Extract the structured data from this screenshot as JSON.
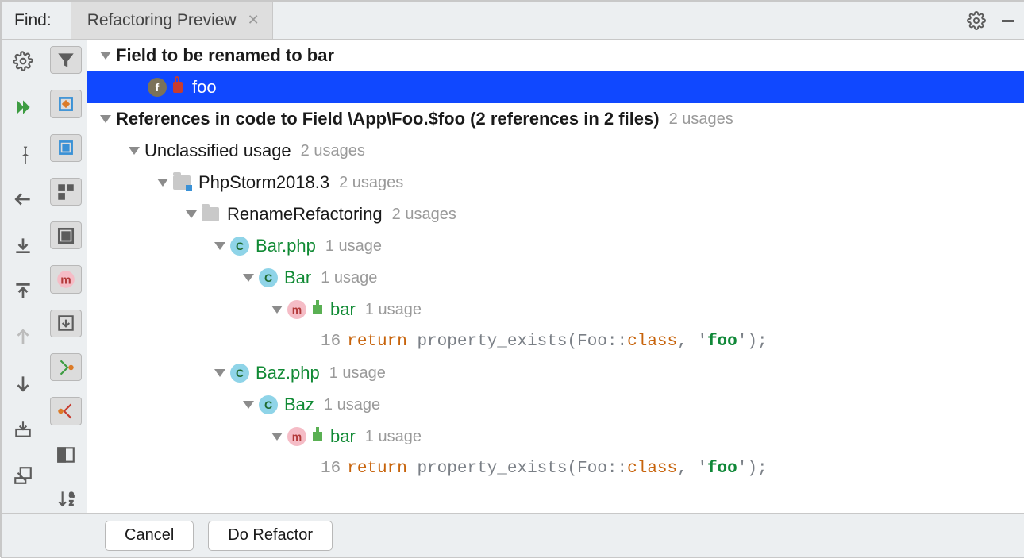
{
  "header": {
    "find_label": "Find:",
    "tab_title": "Refactoring Preview"
  },
  "sidebar_left": [
    {
      "name": "settings",
      "kind": "gear",
      "active": false
    },
    {
      "name": "rerun",
      "kind": "play2",
      "active": false
    },
    {
      "name": "pin",
      "kind": "pin",
      "active": false
    },
    {
      "name": "back",
      "kind": "arrow-left",
      "active": false
    },
    {
      "name": "expand-all",
      "kind": "expand",
      "active": false
    },
    {
      "name": "collapse-all",
      "kind": "collapse",
      "active": false
    },
    {
      "name": "prev",
      "kind": "arrow-up",
      "active": false
    },
    {
      "name": "next",
      "kind": "arrow-down",
      "active": false
    },
    {
      "name": "export",
      "kind": "export",
      "active": false
    },
    {
      "name": "open-new",
      "kind": "open-new",
      "active": false
    }
  ],
  "sidebar_right": [
    {
      "name": "filter",
      "kind": "funnel",
      "active": true
    },
    {
      "name": "group-module",
      "kind": "module",
      "active": true
    },
    {
      "name": "group-file",
      "kind": "file",
      "active": true
    },
    {
      "name": "group-package",
      "kind": "package",
      "active": true
    },
    {
      "name": "group-method",
      "kind": "method",
      "active": true
    },
    {
      "name": "preview-import",
      "kind": "import",
      "active": true
    },
    {
      "name": "show-read",
      "kind": "read",
      "active": true
    },
    {
      "name": "show-write",
      "kind": "write",
      "active": true
    },
    {
      "name": "preview-panel",
      "kind": "panel",
      "active": false
    },
    {
      "name": "sort",
      "kind": "sort",
      "active": false
    }
  ],
  "tree": {
    "field_heading": "Field to be renamed to bar",
    "field_name": "foo",
    "refs_heading": "References in code to Field \\App\\Foo.$foo (2 references in 2 files)",
    "refs_heading_usages": "2 usages",
    "unclassified_label": "Unclassified usage",
    "unclassified_usages": "2 usages",
    "project_name": "PhpStorm2018.3",
    "project_usages": "2 usages",
    "folder_name": "RenameRefactoring",
    "folder_usages": "2 usages",
    "files": [
      {
        "file": "Bar.php",
        "file_usages": "1 usage",
        "class": "Bar",
        "class_usages": "1 usage",
        "method": "bar",
        "method_usages": "1 usage",
        "line_no": "16",
        "code": {
          "kw": "return",
          "sp": " ",
          "fn": "property_exists",
          "open": "(",
          "ns": "Foo::",
          "cls": "class",
          "comma": ", ",
          "q1": "'",
          "str": "foo",
          "q2": "'",
          "close": ");"
        }
      },
      {
        "file": "Baz.php",
        "file_usages": "1 usage",
        "class": "Baz",
        "class_usages": "1 usage",
        "method": "bar",
        "method_usages": "1 usage",
        "line_no": "16",
        "code": {
          "kw": "return",
          "sp": " ",
          "fn": "property_exists",
          "open": "(",
          "ns": "Foo::",
          "cls": "class",
          "comma": ", ",
          "q1": "'",
          "str": "foo",
          "q2": "'",
          "close": ");"
        }
      }
    ]
  },
  "footer": {
    "cancel": "Cancel",
    "do_refactor": "Do Refactor"
  }
}
